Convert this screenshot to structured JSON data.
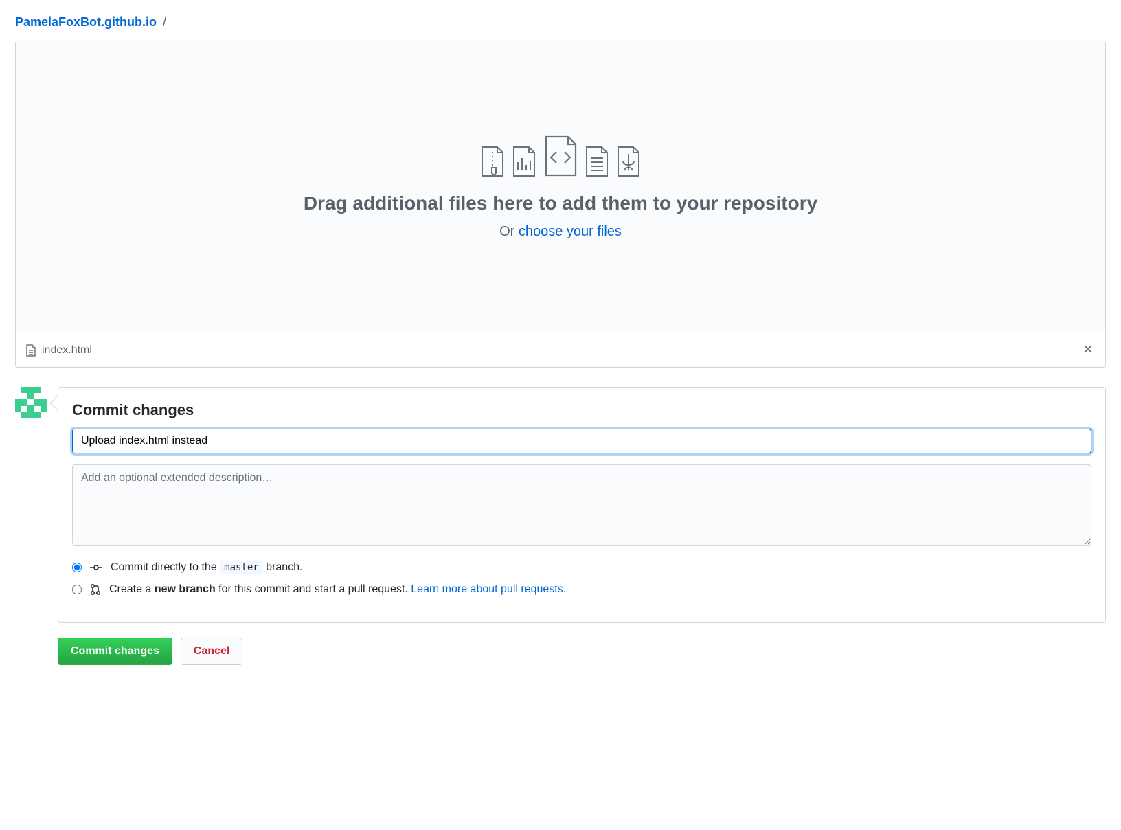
{
  "breadcrumb": {
    "repo": "PamelaFoxBot.github.io",
    "sep": "/"
  },
  "drop": {
    "title": "Drag additional files here to add them to your repository",
    "or": "Or",
    "choose": "choose your files"
  },
  "file": {
    "name": "index.html"
  },
  "commit": {
    "heading": "Commit changes",
    "message": "Upload index.html instead",
    "description_placeholder": "Add an optional extended description…",
    "direct_prefix": "Commit directly to the ",
    "direct_branch": "master",
    "direct_suffix": " branch.",
    "newbranch_prefix": "Create a ",
    "newbranch_bold": "new branch",
    "newbranch_suffix": " for this commit and start a pull request. ",
    "learn_more": "Learn more about pull requests.",
    "submit": "Commit changes",
    "cancel": "Cancel"
  }
}
